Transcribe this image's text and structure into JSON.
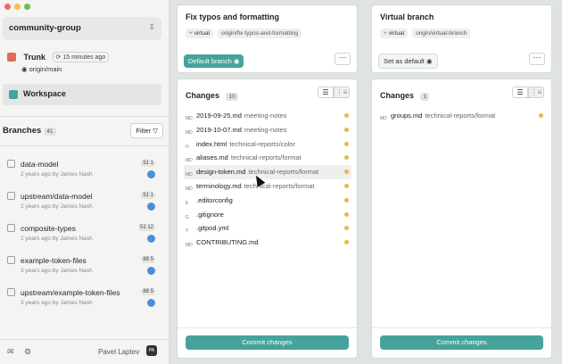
{
  "window": {
    "dot_colors": [
      "#ed6a5e",
      "#f5bf4f",
      "#62c554"
    ]
  },
  "project": {
    "name": "community-group"
  },
  "trunk": {
    "label": "Trunk",
    "time": "⟳ 15 minutes ago",
    "remote": "origin/main"
  },
  "workspace": {
    "label": "Workspace"
  },
  "branches": {
    "title": "Branches",
    "count": "41",
    "filter_label": "Filter",
    "items": [
      {
        "name": "data-model",
        "meta": "2 years ago by James Nash",
        "count": "51 1"
      },
      {
        "name": "upstream/data-model",
        "meta": "2 years ago by James Nash",
        "count": "51 1"
      },
      {
        "name": "composite-types",
        "meta": "2 years ago by James Nash",
        "count": "51 12"
      },
      {
        "name": "example-token-files",
        "meta": "3 years ago by James Nash",
        "count": "88 5"
      },
      {
        "name": "upstream/example-token-files",
        "meta": "3 years ago by James Nash",
        "count": "88 5"
      }
    ]
  },
  "user": {
    "name": "Pavel Laptev",
    "initials": "PA"
  },
  "lanes": [
    {
      "title": "Fix typos and formatting",
      "tag1": "virtual",
      "tag2": "origin/fix-typos-and-formatting",
      "default_btn": "Default branch",
      "changes_title": "Changes",
      "changes_count": "10",
      "files": [
        {
          "name": "2019-09-25.md",
          "path": "meeting-notes",
          "icon": "MD"
        },
        {
          "name": "2019-10-07.md",
          "path": "meeting-notes",
          "icon": "MD"
        },
        {
          "name": "index.html",
          "path": "technical-reports/color",
          "icon": "H"
        },
        {
          "name": "aliases.md",
          "path": "technical-reports/format",
          "icon": "MD"
        },
        {
          "name": "design-token.md",
          "path": "technical-reports/format",
          "icon": "MD"
        },
        {
          "name": "terminology.md",
          "path": "technical-reports/format",
          "icon": "MD"
        },
        {
          "name": ".editorconfig",
          "path": "",
          "icon": "E"
        },
        {
          "name": ".gitignore",
          "path": "",
          "icon": "G"
        },
        {
          "name": ".gitpod.yml",
          "path": "",
          "icon": "Y"
        },
        {
          "name": "CONTRIBUTING.md",
          "path": "",
          "icon": "MD"
        }
      ],
      "commit_label": "Commit changes"
    },
    {
      "title": "Virtual branch",
      "tag1": "virtual",
      "tag2": "origin/virtual-branch",
      "default_btn": "Set as default",
      "changes_title": "Changes",
      "changes_count": "1",
      "files": [
        {
          "name": "groups.md",
          "path": "technical-reports/format",
          "icon": "MD"
        }
      ],
      "commit_label": "Commit changes"
    }
  ]
}
